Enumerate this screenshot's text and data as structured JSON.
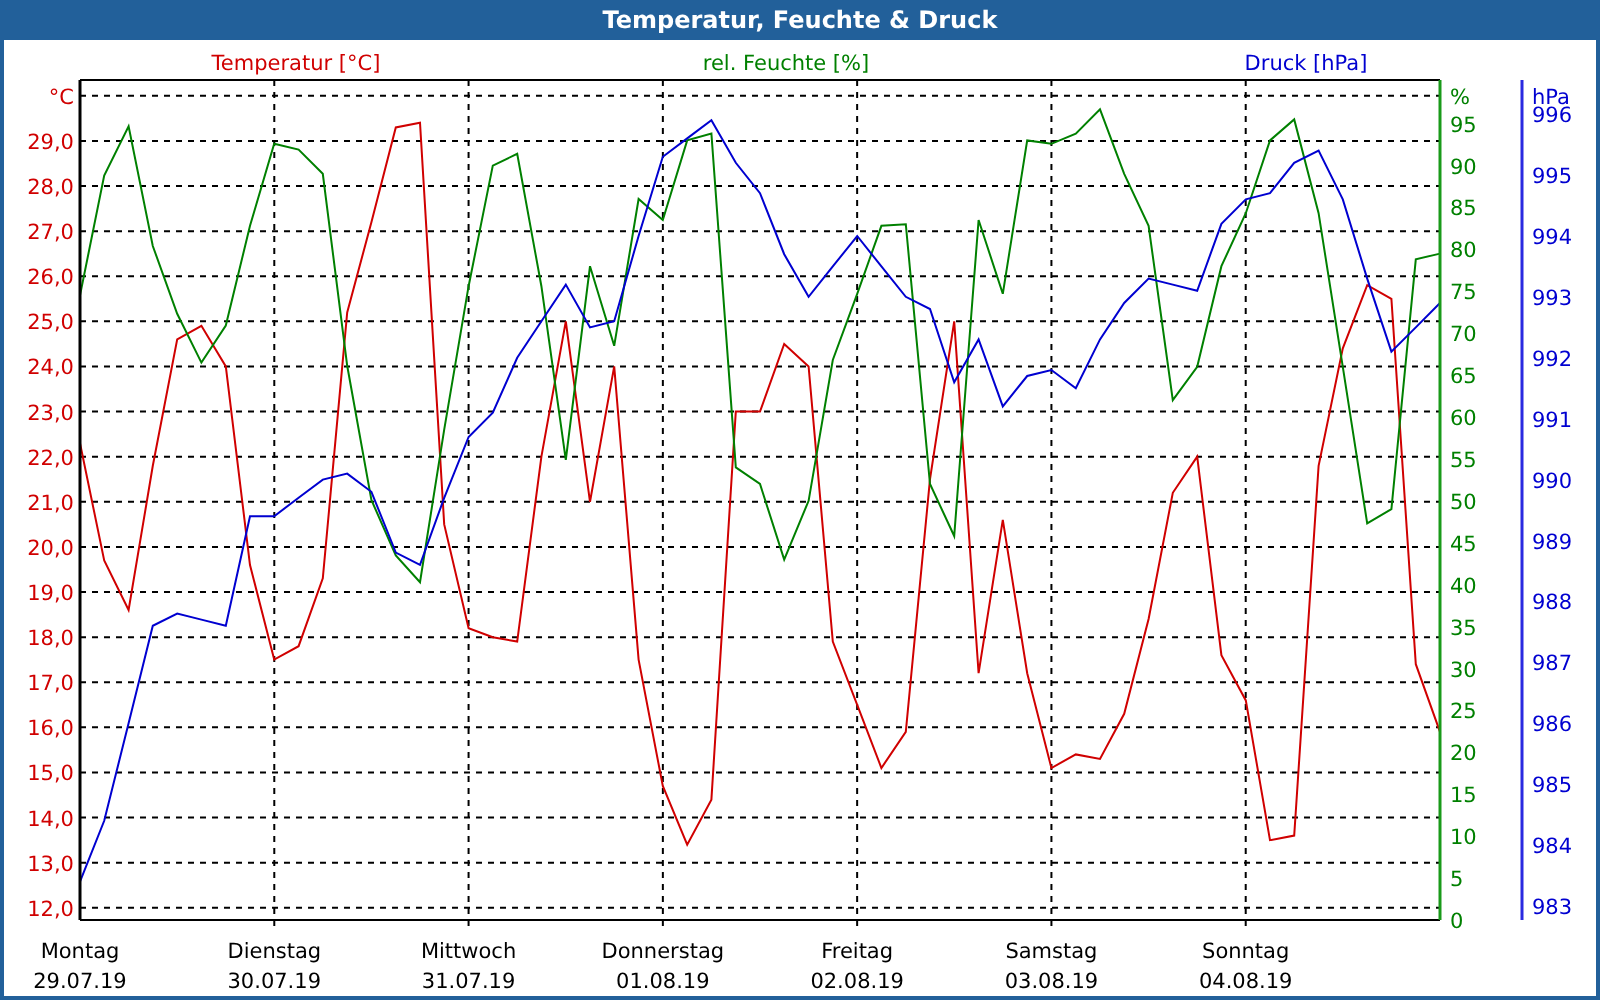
{
  "window": {
    "title": "Temperatur, Feuchte & Druck"
  },
  "chart": {
    "chart_data": {
      "type": "line",
      "grid": true,
      "categories": [
        "Montag\n29.07.19",
        null,
        null,
        null,
        null,
        null,
        null,
        null,
        "Dienstag\n30.07.19",
        null,
        null,
        null,
        null,
        null,
        null,
        null,
        "Mittwoch\n31.07.19",
        null,
        null,
        null,
        null,
        null,
        null,
        null,
        "Donnerstag\n01.08.19",
        null,
        null,
        null,
        null,
        null,
        null,
        null,
        "Freitag\n02.08.19",
        null,
        null,
        null,
        null,
        null,
        null,
        null,
        "Samstag\n03.08.19",
        null,
        null,
        null,
        null,
        null,
        null,
        null,
        "Sonntag\n04.08.19",
        null,
        null,
        null,
        null,
        null,
        null,
        null,
        null
      ],
      "ylabel": "°C",
      "ylim": [
        11.73,
        30.35
      ],
      "yticks": [
        {
          "value": 12,
          "label": "12,0"
        },
        {
          "value": 13,
          "label": "13,0"
        },
        {
          "value": 14,
          "label": "14,0"
        },
        {
          "value": 15,
          "label": "15,0"
        },
        {
          "value": 16,
          "label": "16,0"
        },
        {
          "value": 17,
          "label": "17,0"
        },
        {
          "value": 18,
          "label": "18,0"
        },
        {
          "value": 19,
          "label": "19,0"
        },
        {
          "value": 20,
          "label": "20,0"
        },
        {
          "value": 21,
          "label": "21,0"
        },
        {
          "value": 22,
          "label": "22,0"
        },
        {
          "value": 23,
          "label": "23,0"
        },
        {
          "value": 24,
          "label": "24,0"
        },
        {
          "value": 25,
          "label": "25,0"
        },
        {
          "value": 26,
          "label": "26,0"
        },
        {
          "value": 27,
          "label": "27,0"
        },
        {
          "value": 28,
          "label": "28,0"
        },
        {
          "value": 29,
          "label": "29,0"
        }
      ],
      "y2label": "%",
      "y2lim": [
        0,
        100.2
      ],
      "y2ticks": [
        0,
        5,
        10,
        15,
        20,
        25,
        30,
        35,
        40,
        45,
        50,
        55,
        60,
        65,
        70,
        75,
        80,
        85,
        90,
        95
      ],
      "y3label": "hPa",
      "y3lim": [
        982.77,
        996.56
      ],
      "y3ticks": [
        983,
        984,
        985,
        986,
        987,
        988,
        989,
        990,
        991,
        992,
        993,
        994,
        995,
        996
      ],
      "series": [
        {
          "name": "Temperatur [°C]",
          "color": "#d00000",
          "values": [
            22.3,
            19.7,
            18.6,
            21.8,
            24.6,
            24.9,
            24.0,
            19.6,
            17.5,
            17.8,
            19.3,
            25.2,
            27.2,
            29.3,
            29.4,
            20.5,
            18.2,
            18.0,
            17.9,
            22.0,
            25.0,
            21.0,
            24.0,
            17.5,
            14.7,
            13.4,
            14.4,
            23.0,
            23.0,
            24.5,
            24.0,
            17.9,
            16.5,
            15.1,
            15.9,
            21.5,
            25.0,
            17.2,
            20.6,
            17.2,
            15.1,
            15.4,
            15.3,
            16.3,
            18.4,
            21.2,
            22.0,
            17.6,
            16.6,
            13.5,
            13.6,
            21.8,
            24.4,
            25.8,
            25.5,
            17.4,
            15.9
          ]
        },
        {
          "name": "rel. Feuchte [%]",
          "color": "#008000",
          "axis": "y2",
          "values": [
            74.5,
            88.8,
            94.7,
            80.4,
            72.3,
            66.5,
            70.9,
            82.8,
            92.6,
            91.9,
            89.0,
            66.1,
            50.1,
            43.5,
            40.3,
            58.5,
            75.6,
            90,
            91.4,
            75.6,
            54.9,
            78,
            68.5,
            86,
            83.5,
            93,
            93.8,
            54,
            52,
            43,
            50,
            66.8,
            74.7,
            82.8,
            83,
            52,
            45.8,
            83.5,
            74.7,
            93,
            92.6,
            93.8,
            96.7,
            89,
            82.8,
            62,
            66,
            78,
            84.3,
            93,
            95.5,
            84.3,
            66,
            47.3,
            49,
            78.8,
            79.5
          ]
        },
        {
          "name": "Druck [hPa]",
          "color": "#0000d0",
          "axis": "y3",
          "values": [
            983.4,
            984.4,
            986.0,
            987.6,
            987.8,
            987.7,
            987.6,
            989.4,
            989.4,
            989.7,
            990.0,
            990.1,
            989.8,
            988.8,
            988.6,
            989.7,
            990.7,
            991.1,
            992.0,
            992.6,
            993.2,
            992.5,
            992.6,
            994.0,
            995.3,
            995.6,
            995.9,
            995.2,
            994.7,
            993.7,
            993.0,
            993.5,
            994.0,
            993.5,
            993.0,
            992.8,
            991.6,
            992.3,
            991.2,
            991.7,
            991.8,
            991.5,
            992.3,
            992.9,
            993.3,
            993.2,
            993.1,
            994.2,
            994.6,
            994.7,
            995.2,
            995.4,
            994.6,
            993.3,
            992.1,
            992.5,
            992.9
          ]
        }
      ]
    }
  }
}
